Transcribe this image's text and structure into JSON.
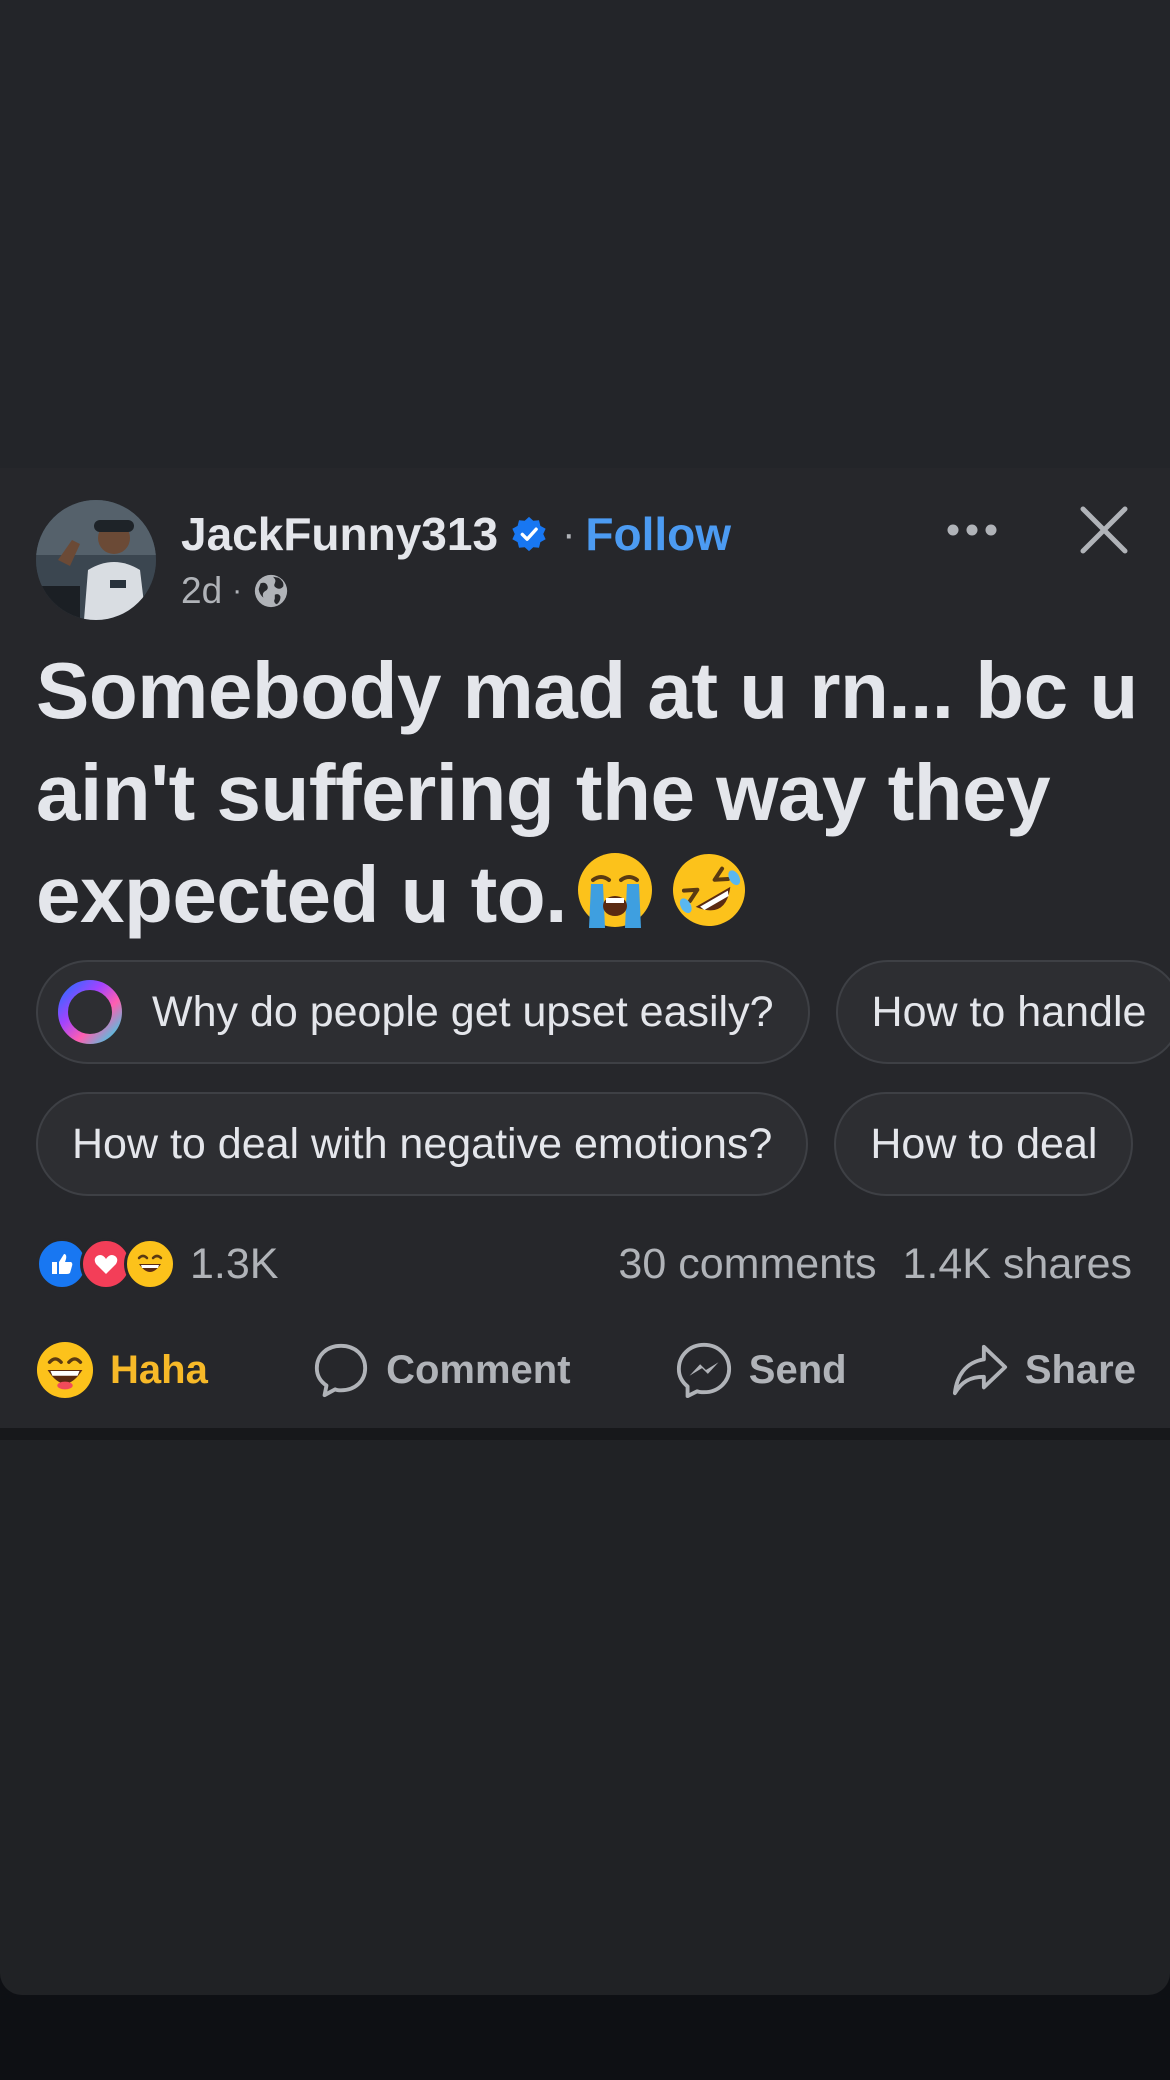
{
  "post": {
    "author": "JackFunny313",
    "separator": "·",
    "follow_label": "Follow",
    "time": "2d",
    "time_separator": "·",
    "text": "Somebody mad at u rn... bc u ain't suffering the way they expected u to.",
    "text_emojis": [
      "loudly-crying-face",
      "rolling-on-floor-laughing"
    ]
  },
  "suggestions": {
    "row1": [
      "Why do people get upset easily?",
      "How to handle"
    ],
    "row2": [
      "How to deal with negative emotions?",
      "How to deal"
    ]
  },
  "stats": {
    "reactions": [
      "like",
      "love",
      "haha"
    ],
    "reaction_count": "1.3K",
    "comments": "30 comments",
    "shares": "1.4K shares"
  },
  "actions": {
    "haha_label": "Haha",
    "comment_label": "Comment",
    "send_label": "Send",
    "share_label": "Share"
  },
  "colors": {
    "accent": "#4c9bf2",
    "haha": "#f7b928",
    "background": "#26272b",
    "verified": "#1877f2"
  }
}
